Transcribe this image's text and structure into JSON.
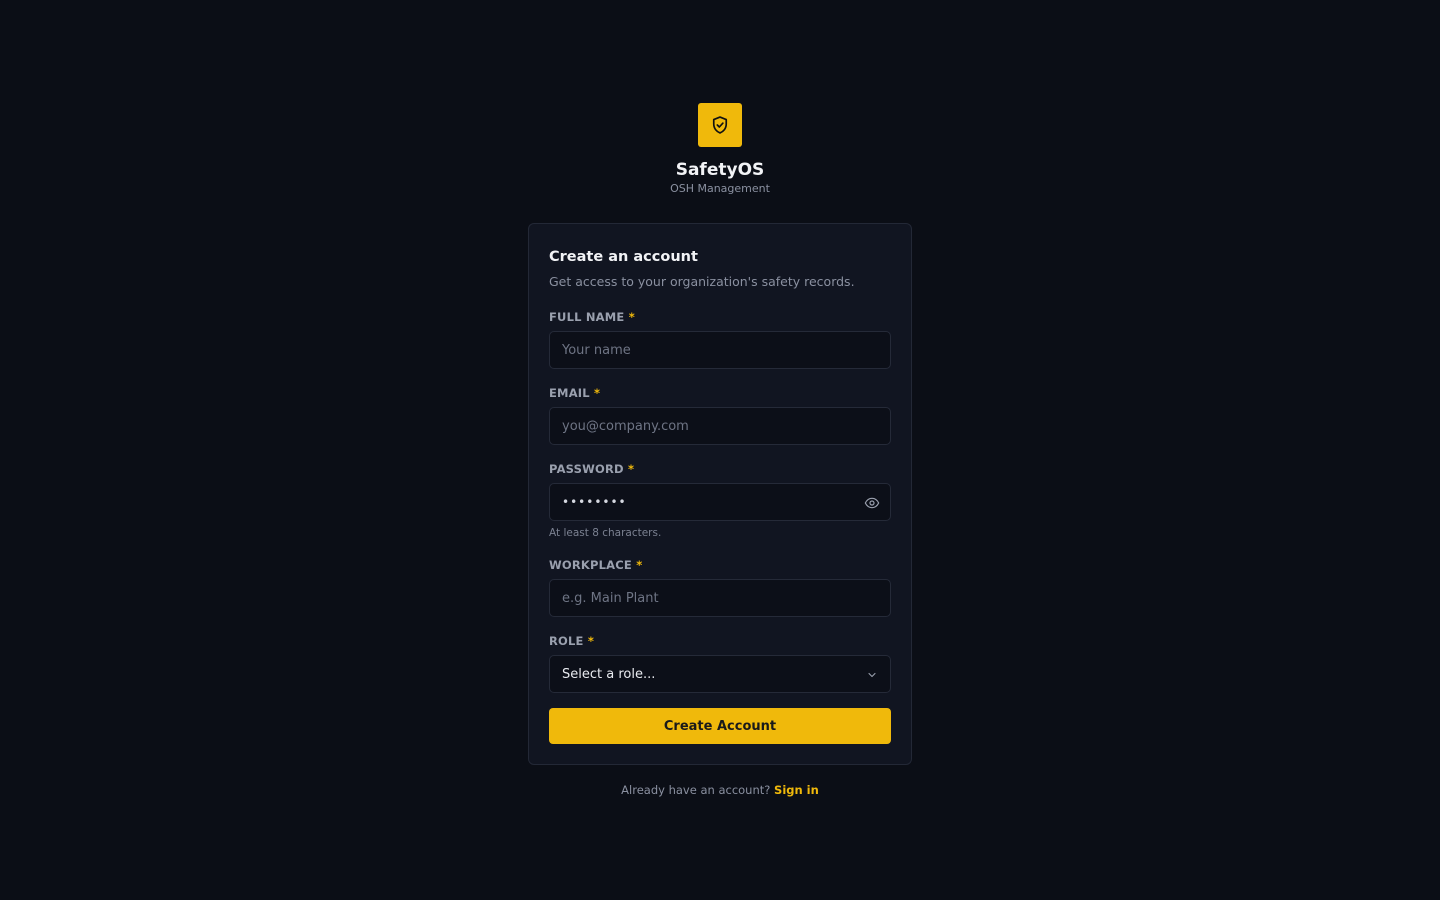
{
  "brand": {
    "name": "SafetyOS",
    "subtitle": "OSH Management",
    "accent": "#f0b90b"
  },
  "form": {
    "title": "Create an account",
    "subtitle": "Get access to your organization's safety records.",
    "fields": {
      "full_name": {
        "label": "FULL NAME",
        "required": "*",
        "placeholder": "Your name"
      },
      "email": {
        "label": "EMAIL",
        "required": "*",
        "placeholder": "you@company.com"
      },
      "password": {
        "label": "PASSWORD",
        "required": "*",
        "value": "••••••••",
        "hint": "At least 8 characters."
      },
      "workplace": {
        "label": "WORKPLACE",
        "required": "*",
        "placeholder": "e.g. Main Plant"
      },
      "role": {
        "label": "ROLE",
        "required": "*",
        "selected": "Select a role..."
      }
    },
    "submit_label": "Create Account"
  },
  "footer": {
    "prompt": "Already have an account?",
    "link": "Sign in"
  },
  "icons": {
    "logo": "shield-check-icon",
    "password_toggle": "eye-icon",
    "role_dropdown": "chevron-down-icon"
  }
}
